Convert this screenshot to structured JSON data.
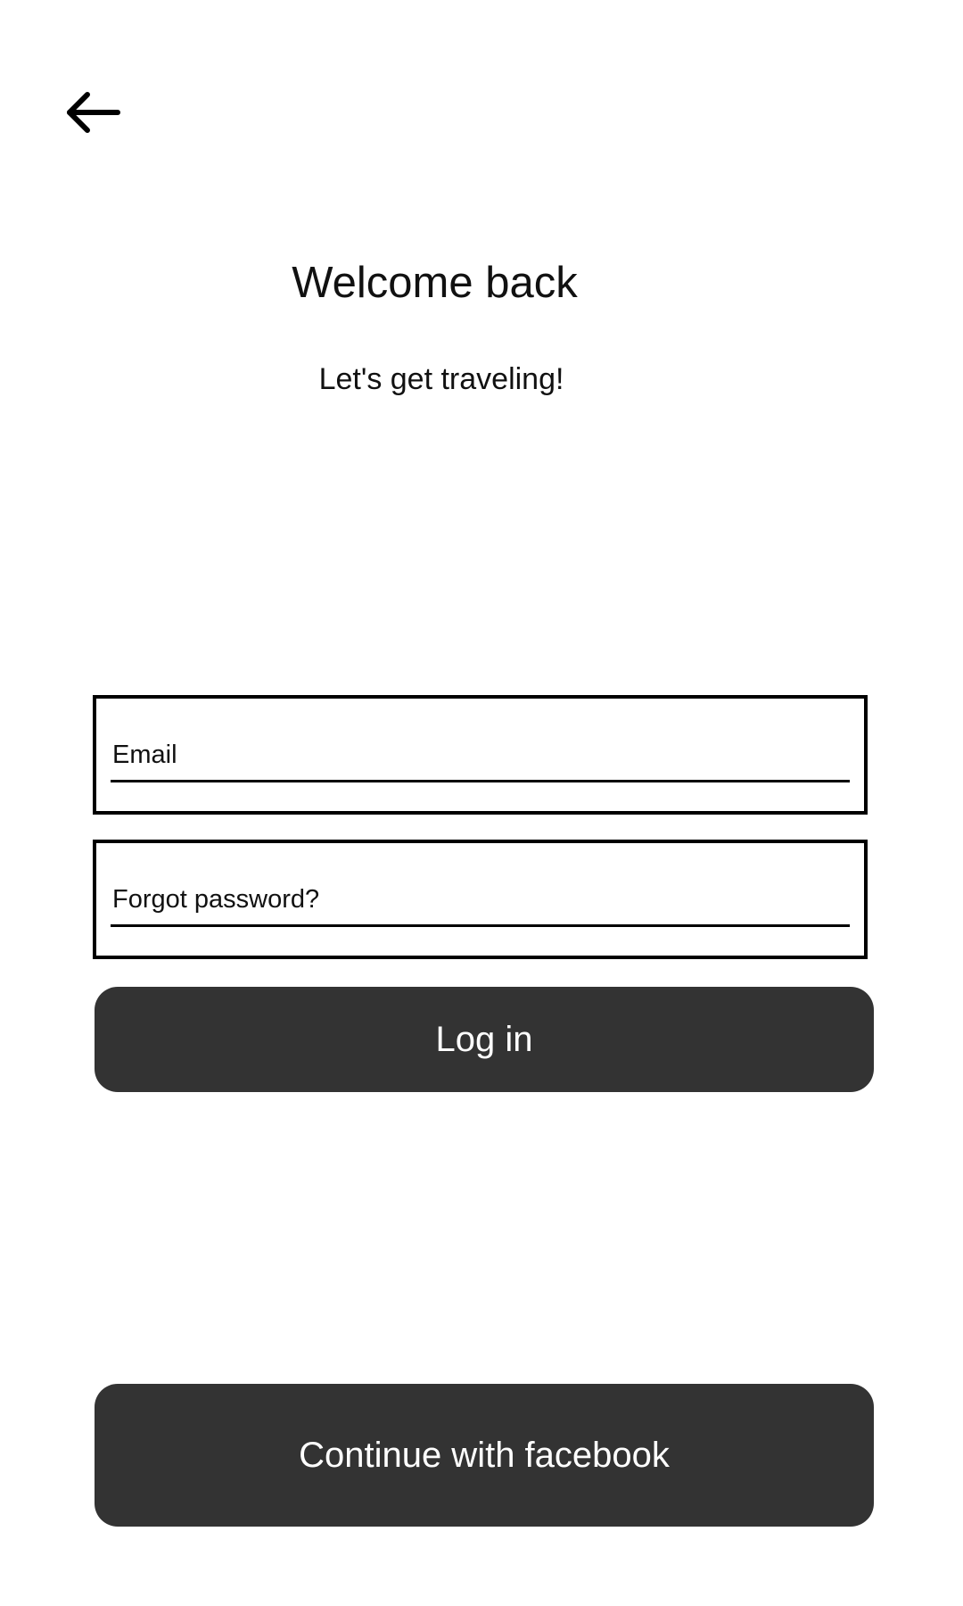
{
  "header": {
    "back_icon": "arrow-left-icon"
  },
  "main": {
    "title": "Welcome back",
    "subtitle": "Let's get traveling!"
  },
  "form": {
    "email_placeholder": "Email",
    "password_placeholder": "Forgot password?",
    "login_label": "Log in"
  },
  "social": {
    "facebook_label": "Continue with facebook"
  },
  "colors": {
    "button_bg": "#333333",
    "button_text": "#ffffff",
    "border": "#000000"
  }
}
